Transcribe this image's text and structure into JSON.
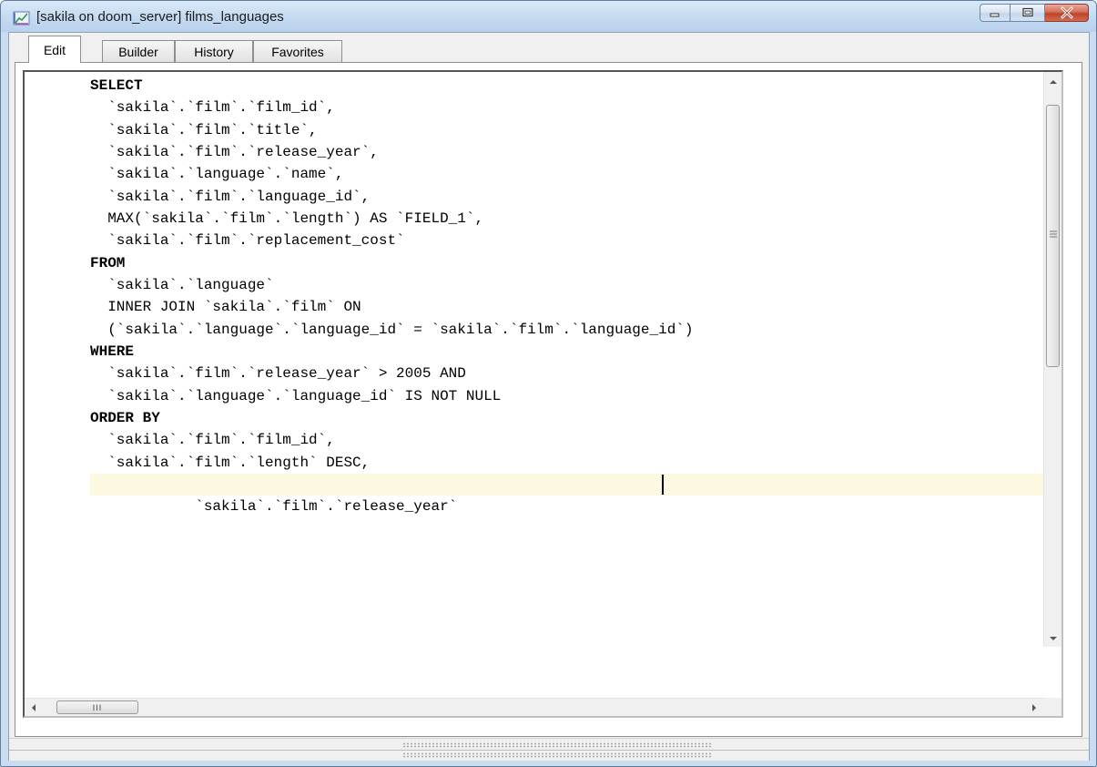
{
  "window": {
    "title": "[sakila on doom_server] films_languages",
    "icon": "query-editor-icon",
    "controls": [
      "minimize-icon",
      "maximize-icon",
      "close-icon"
    ]
  },
  "tabs": [
    {
      "label": "Edit",
      "active": true
    },
    {
      "label": "Builder",
      "active": false
    },
    {
      "label": "History",
      "active": false
    },
    {
      "label": "Favorites",
      "active": false
    }
  ],
  "editor": {
    "lines": [
      "SELECT",
      "  `sakila`.`film`.`film_id`,",
      "  `sakila`.`film`.`title`,",
      "  `sakila`.`film`.`release_year`,",
      "  `sakila`.`language`.`name`,",
      "  `sakila`.`film`.`language_id`,",
      "  MAX(`sakila`.`film`.`length`) AS `FIELD_1`,",
      "  `sakila`.`film`.`replacement_cost`",
      "FROM",
      "  `sakila`.`language`",
      "  INNER JOIN `sakila`.`film` ON",
      "  (`sakila`.`language`.`language_id` = `sakila`.`film`.`language_id`)",
      "WHERE",
      "  `sakila`.`film`.`release_year` > 2005 AND",
      "  `sakila`.`language`.`language_id` IS NOT NULL",
      "ORDER BY",
      "  `sakila`.`film`.`film_id`,",
      "  `sakila`.`film`.`length` DESC,",
      "  `sakila`.`film`.`release_year`"
    ],
    "current_line": 19
  },
  "scrollbars": {
    "horizontal_thumb_glyph": "III"
  },
  "colors": {
    "title_gradient": "#c6dbf1",
    "close_button": "#c0432b",
    "current_line_highlight": "#fcf9e0"
  }
}
